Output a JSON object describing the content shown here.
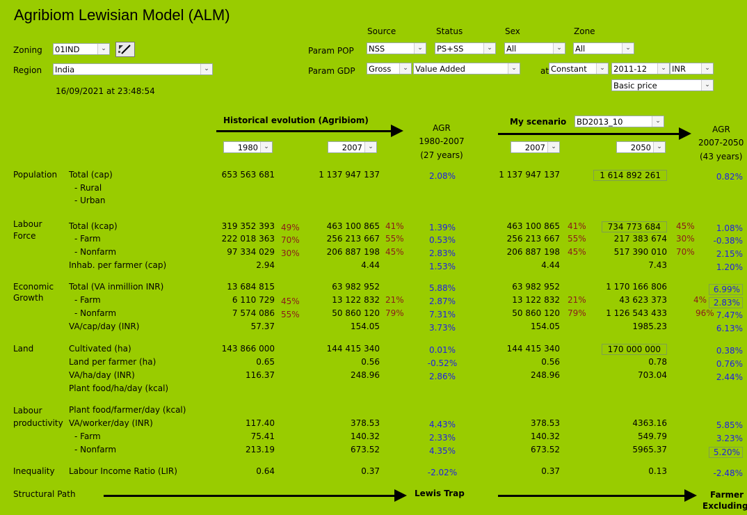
{
  "title": "Agribiom Lewisian Model (ALM)",
  "zoning": {
    "label": "Zoning",
    "value": "01IND"
  },
  "region": {
    "label": "Region",
    "value": "India"
  },
  "timestamp": "16/09/2021 at 23:48:54",
  "params": {
    "source_h": "Source",
    "status_h": "Status",
    "sex_h": "Sex",
    "zone_h": "Zone",
    "pop_label": "Param POP",
    "pop_source": "NSS",
    "pop_status": "PS+SS",
    "pop_sex": "All",
    "pop_zone": "All",
    "gdp_label": "Param GDP",
    "gdp_gross": "Gross",
    "gdp_va": "Value Added",
    "at_label": "at",
    "gdp_constant": "Constant",
    "gdp_year": "2011-12",
    "gdp_currency": "INR",
    "gdp_basic": "Basic price"
  },
  "hist": {
    "title": "Historical evolution (Agribiom)",
    "y1": "1980",
    "y2": "2007"
  },
  "agr1": {
    "h1": "AGR",
    "h2": "1980-2007",
    "h3": "(27 years)"
  },
  "scen": {
    "title": "My scenario",
    "name": "BD2013_10",
    "y1": "2007",
    "y2": "2050"
  },
  "agr2": {
    "h1": "AGR",
    "h2": "2007-2050",
    "h3": "(43 years)"
  },
  "sections": {
    "population": "Population",
    "labour1": "Labour",
    "labour2": "Force",
    "econ1": "Economic",
    "econ2": "Growth",
    "land": "Land",
    "lp1": "Labour",
    "lp2": "productivity",
    "ineq": "Inequality",
    "struct": "Structural Path"
  },
  "rows": {
    "pop_total": {
      "label": "Total (cap)",
      "v1": "653 563 681",
      "v2": "1 137 947 137",
      "agr": "2.08%",
      "v3": "1 137 947 137",
      "v4": "1 614 892 261",
      "agr2": "0.82%"
    },
    "pop_rural": {
      "label": "- Rural"
    },
    "pop_urban": {
      "label": "- Urban"
    },
    "lf_total": {
      "label": "Total (kcap)",
      "v1": "319 352 393",
      "p1": "49%",
      "v2": "463 100 865",
      "p2": "41%",
      "agr": "1.39%",
      "v3": "463 100 865",
      "p3": "41%",
      "v4": "734 773 684",
      "p4": "45%",
      "agr2": "1.08%"
    },
    "lf_farm": {
      "label": "- Farm",
      "v1": "222 018 363",
      "p1": "70%",
      "v2": "256 213 667",
      "p2": "55%",
      "agr": "0.53%",
      "v3": "256 213 667",
      "p3": "55%",
      "v4": "217 383 674",
      "p4": "30%",
      "agr2": "-0.38%"
    },
    "lf_nonfarm": {
      "label": "- Nonfarm",
      "v1": "97 334 029",
      "p1": "30%",
      "v2": "206 887 198",
      "p2": "45%",
      "agr": "2.83%",
      "v3": "206 887 198",
      "p3": "45%",
      "v4": "517 390 010",
      "p4": "70%",
      "agr2": "2.15%"
    },
    "lf_inhab": {
      "label": "Inhab. per farmer (cap)",
      "v1": "2.94",
      "v2": "4.44",
      "agr": "1.53%",
      "v3": "4.44",
      "v4": "7.43",
      "agr2": "1.20%"
    },
    "eg_total": {
      "label": "Total (VA inmillion INR)",
      "v1": "13 684 815",
      "v2": "63 982 952",
      "agr": "5.88%",
      "v3": "63 982 952",
      "v4": "1 170 166 806",
      "agr2": "6.99%"
    },
    "eg_farm": {
      "label": "- Farm",
      "v1": "6 110 729",
      "p1": "45%",
      "v2": "13 122 832",
      "p2": "21%",
      "agr": "2.87%",
      "v3": "13 122 832",
      "p3": "21%",
      "v4": "43 623 373",
      "p4": "4%",
      "agr2": "2.83%"
    },
    "eg_nonfarm": {
      "label": "- Nonfarm",
      "v1": "7 574 086",
      "p1": "55%",
      "v2": "50 860 120",
      "p2": "79%",
      "agr": "7.31%",
      "v3": "50 860 120",
      "p3": "79%",
      "v4": "1 126 543 433",
      "p4": "96%",
      "agr2": "7.47%"
    },
    "eg_va": {
      "label": "VA/cap/day (INR)",
      "v1": "57.37",
      "v2": "154.05",
      "agr": "3.73%",
      "v3": "154.05",
      "v4": "1985.23",
      "agr2": "6.13%"
    },
    "ld_cult": {
      "label": "Cultivated (ha)",
      "v1": "143 866 000",
      "v2": "144 415 340",
      "agr": "0.01%",
      "v3": "144 415 340",
      "v4": "170 000 000",
      "agr2": "0.38%"
    },
    "ld_lpf": {
      "label": "Land per farmer (ha)",
      "v1": "0.65",
      "v2": "0.56",
      "agr": "-0.52%",
      "v3": "0.56",
      "v4": "0.78",
      "agr2": "0.76%"
    },
    "ld_vaha": {
      "label": "VA/ha/day (INR)",
      "v1": "116.37",
      "v2": "248.96",
      "agr": "2.86%",
      "v3": "248.96",
      "v4": "703.04",
      "agr2": "2.44%"
    },
    "ld_pf": {
      "label": "Plant food/ha/day (kcal)"
    },
    "lp_pf": {
      "label": "Plant food/farmer/day (kcal)"
    },
    "lp_va": {
      "label": "VA/worker/day (INR)",
      "v1": "117.40",
      "v2": "378.53",
      "agr": "4.43%",
      "v3": "378.53",
      "v4": "4363.16",
      "agr2": "5.85%"
    },
    "lp_farm": {
      "label": "- Farm",
      "v1": "75.41",
      "v2": "140.32",
      "agr": "2.33%",
      "v3": "140.32",
      "v4": "549.79",
      "agr2": "3.23%"
    },
    "lp_nonfarm": {
      "label": "- Nonfarm",
      "v1": "213.19",
      "v2": "673.52",
      "agr": "4.35%",
      "v3": "673.52",
      "v4": "5965.37",
      "agr2": "5.20%"
    },
    "ineq_lir": {
      "label": "Labour Income Ratio (LIR)",
      "v1": "0.64",
      "v2": "0.37",
      "agr": "-2.02%",
      "v3": "0.37",
      "v4": "0.13",
      "agr2": "-2.48%"
    }
  },
  "struct": {
    "hist": "Lewis Trap",
    "scen1": "Farmer",
    "scen2": "Excluding"
  },
  "colors": {
    "background": "#99cc00",
    "percent": "#8b1a1a",
    "agr": "#1e1ee6"
  }
}
